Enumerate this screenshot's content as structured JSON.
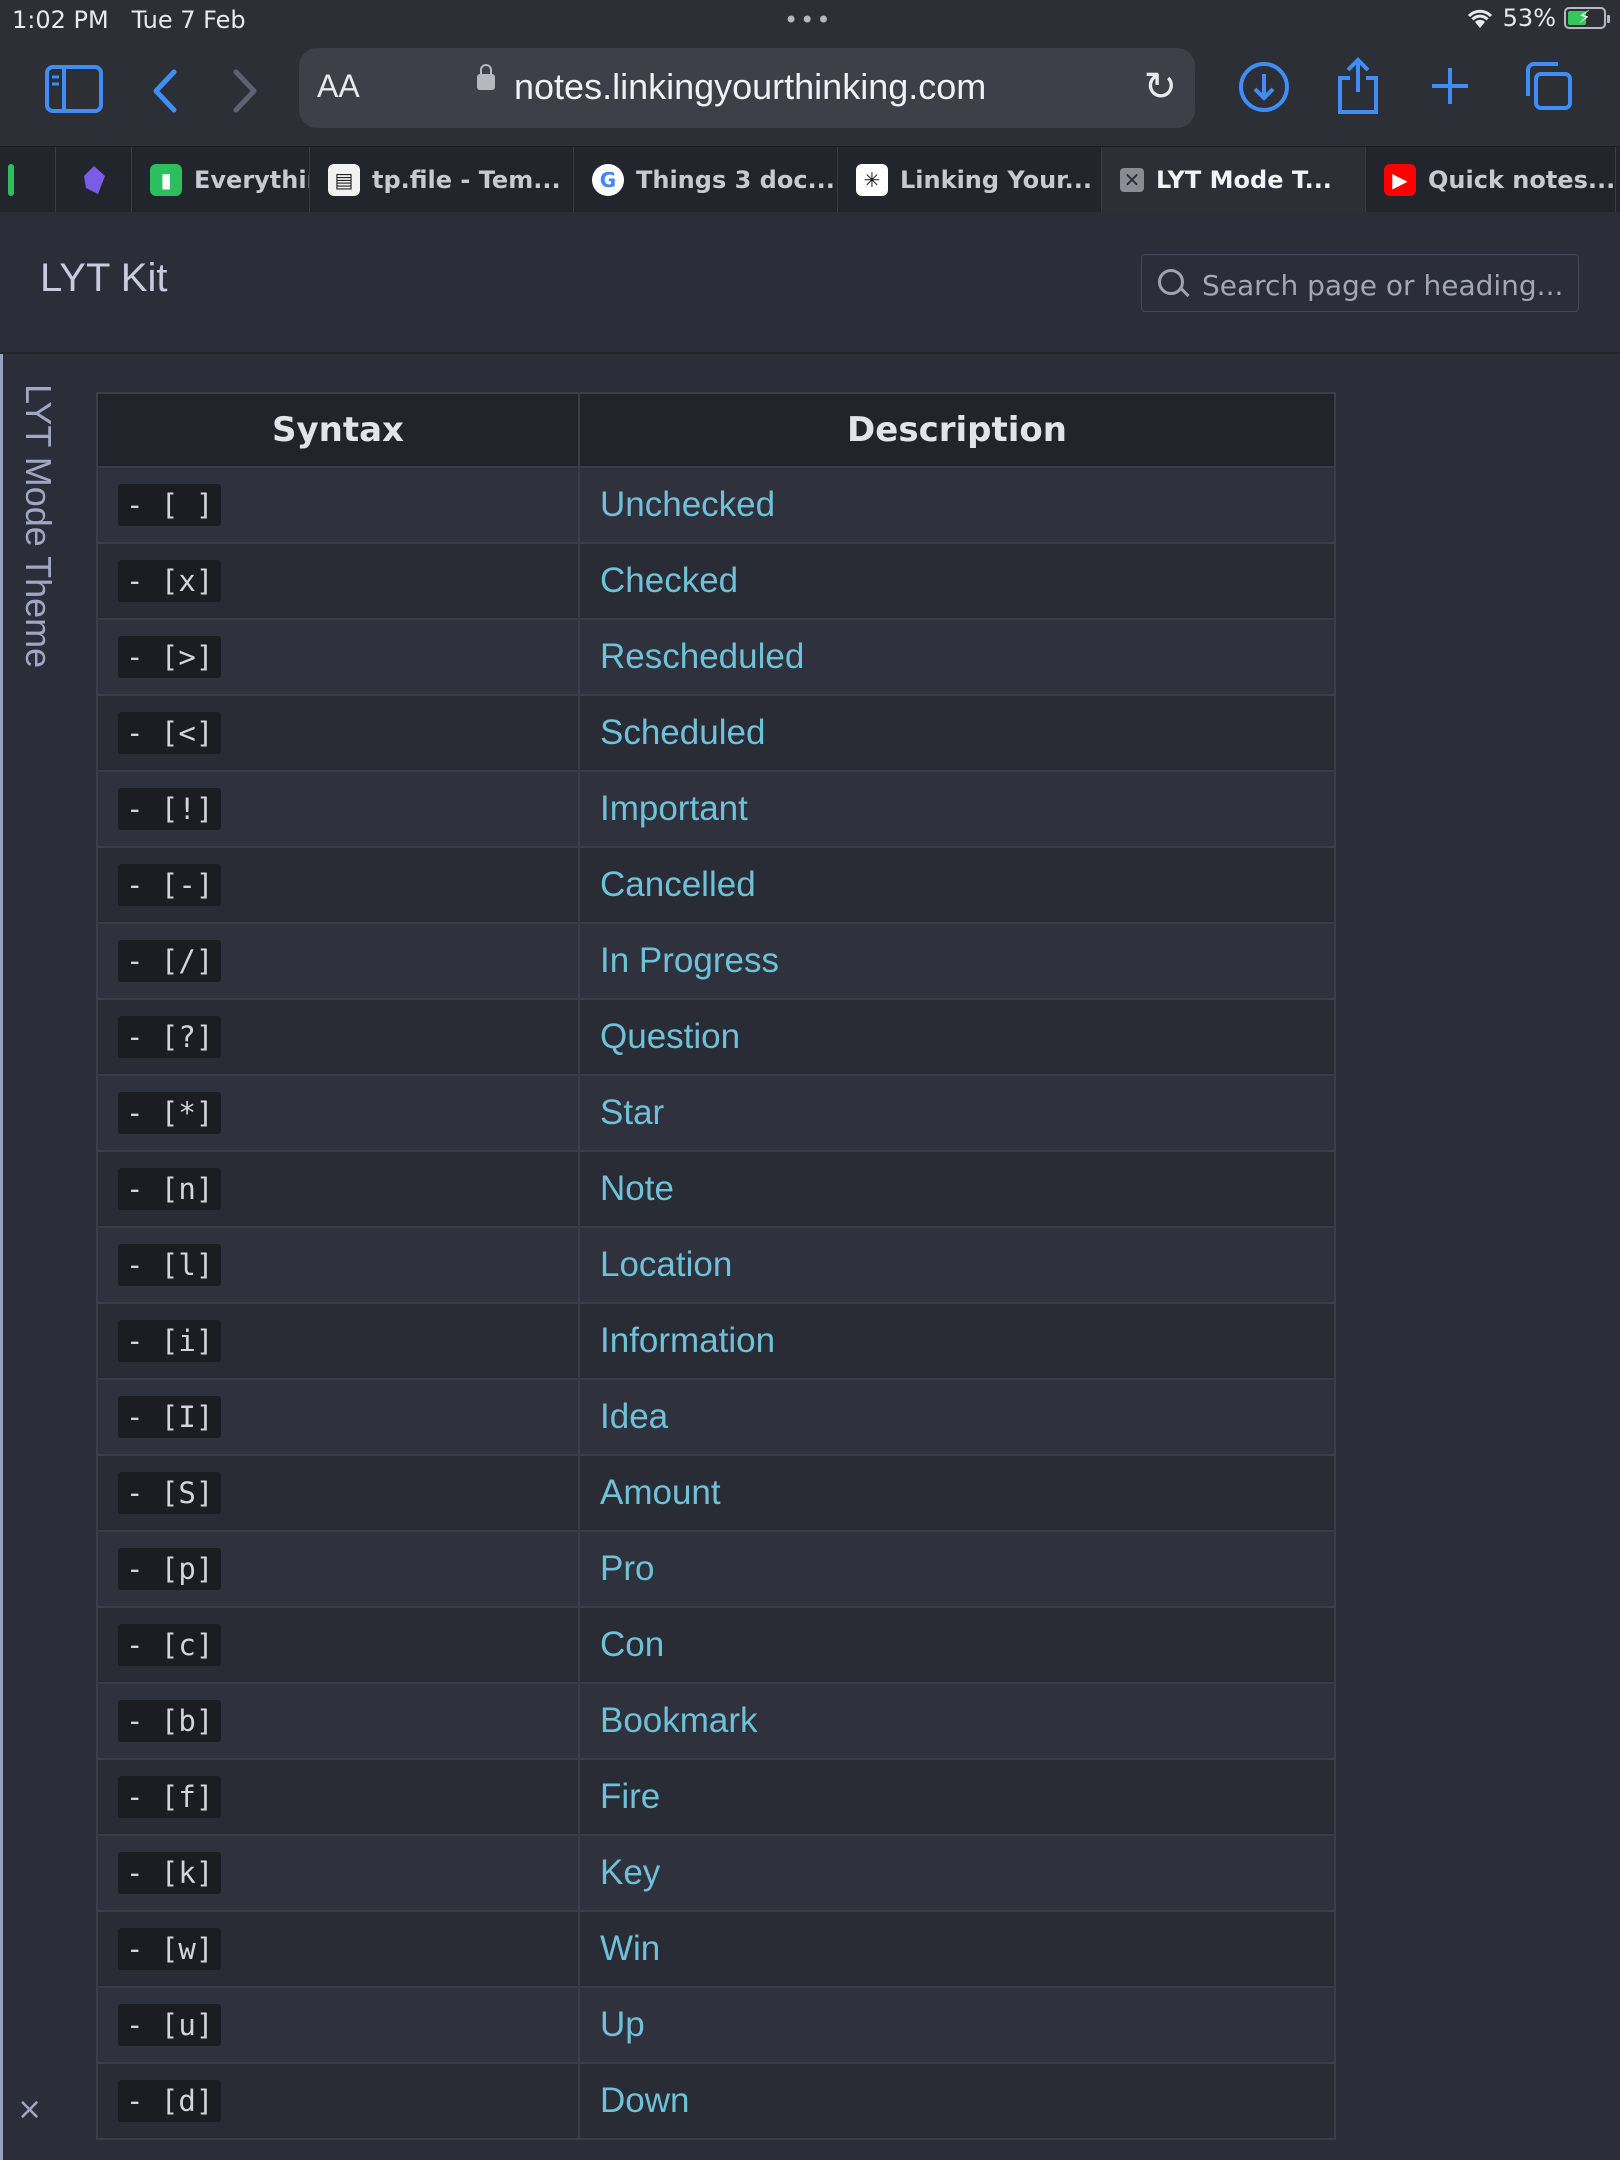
{
  "status": {
    "time": "1:02 PM",
    "date": "Tue 7 Feb",
    "battery": "53%",
    "battery_level": 0.53,
    "dots": "•••"
  },
  "browser": {
    "aa_label": "AA",
    "url": "notes.linkingyourthinking.com",
    "accent": "#3f8ef7"
  },
  "tabs": [
    {
      "title": "Everythin",
      "icon": "evernote-icon",
      "color": "#2dbe60",
      "active": false
    },
    {
      "title": "tp.file - Tem...",
      "icon": "templater-icon",
      "color": "#f2f2f2",
      "active": false
    },
    {
      "title": "Things 3 doc...",
      "icon": "google-icon",
      "color": "#ffffff",
      "active": false
    },
    {
      "title": "Linking Your...",
      "icon": "lyt-icon",
      "color": "#ffffff",
      "active": false
    },
    {
      "title": "LYT Mode T...",
      "icon": "close-icon",
      "color": "#8a8d96",
      "active": true
    },
    {
      "title": "Quick notes...",
      "icon": "youtube-icon",
      "color": "#ff0000",
      "active": false
    }
  ],
  "page": {
    "site_title": "LYT Kit",
    "search_placeholder": "Search page or heading...",
    "rail_label": "LYT Mode Theme",
    "rail_close": "×"
  },
  "table": {
    "headers": [
      "Syntax",
      "Description"
    ],
    "rows": [
      {
        "syntax": "- [ ]",
        "desc": "Unchecked"
      },
      {
        "syntax": "- [x]",
        "desc": "Checked"
      },
      {
        "syntax": "- [>]",
        "desc": "Rescheduled"
      },
      {
        "syntax": "- [<]",
        "desc": "Scheduled"
      },
      {
        "syntax": "- [!]",
        "desc": "Important"
      },
      {
        "syntax": "- [-]",
        "desc": "Cancelled"
      },
      {
        "syntax": "- [/]",
        "desc": "In Progress"
      },
      {
        "syntax": "- [?]",
        "desc": "Question"
      },
      {
        "syntax": "- [*]",
        "desc": "Star"
      },
      {
        "syntax": "- [n]",
        "desc": "Note"
      },
      {
        "syntax": "- [l]",
        "desc": "Location"
      },
      {
        "syntax": "- [i]",
        "desc": "Information"
      },
      {
        "syntax": "- [I]",
        "desc": "Idea"
      },
      {
        "syntax": "- [S]",
        "desc": "Amount"
      },
      {
        "syntax": "- [p]",
        "desc": "Pro"
      },
      {
        "syntax": "- [c]",
        "desc": "Con"
      },
      {
        "syntax": "- [b]",
        "desc": "Bookmark"
      },
      {
        "syntax": "- [f]",
        "desc": "Fire"
      },
      {
        "syntax": "- [k]",
        "desc": "Key"
      },
      {
        "syntax": "- [w]",
        "desc": "Win"
      },
      {
        "syntax": "- [u]",
        "desc": "Up"
      },
      {
        "syntax": "- [d]",
        "desc": "Down"
      }
    ]
  }
}
